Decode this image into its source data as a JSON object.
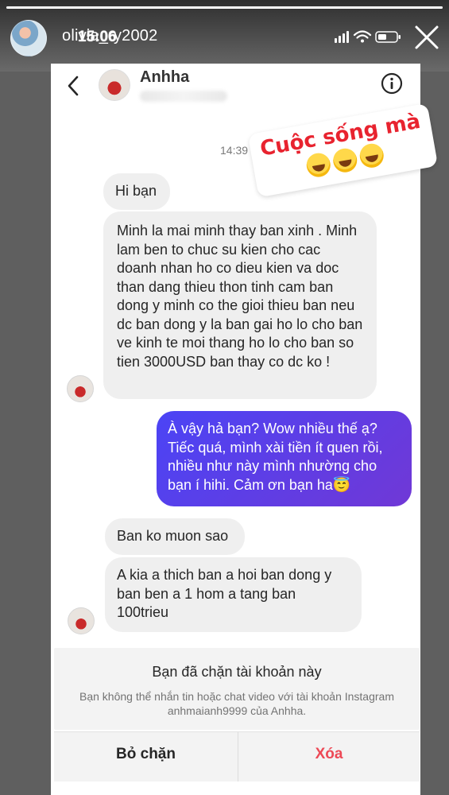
{
  "story": {
    "username": "olivia_ry2002",
    "time": "15:06"
  },
  "chat": {
    "contact_name": "Anhha",
    "timestamp": "14:39"
  },
  "messages": [
    {
      "from": "contact",
      "text": "Hi bạn"
    },
    {
      "from": "contact",
      "text": "Minh la mai minh thay ban xinh . Minh lam  ben to chuc su kien cho cac doanh nhan ho co dieu kien va doc than dang thieu thon tinh cam ban dong y minh co the gioi thieu ban neu dc ban dong y la ban gai ho lo cho ban ve kinh te moi thang ho lo cho ban so tien 3000USD ban thay co dc ko !"
    },
    {
      "from": "me",
      "text": "À vậy hả bạn? Wow nhiều thế ạ? Tiếc quá, mình xài tiền ít quen rồi, nhiều như này mình nhường cho bạn í hihi. Cảm ơn bạn ha😇"
    },
    {
      "from": "contact",
      "text": "Ban ko muon sao"
    },
    {
      "from": "contact",
      "text": "A kia a thich ban a hoi ban dong y ban ben a 1 hom a tang ban 100trieu"
    }
  ],
  "sticker": {
    "text": "Cuộc sống mà",
    "emoji": "🤣🤣🤣"
  },
  "blocked": {
    "title": "Bạn đã chặn tài khoản này",
    "description": "Bạn không thể nhắn tin hoặc chat video với tài khoản Instagram anhmaianh9999 của Anhha."
  },
  "actions": {
    "unblock_label": "Bỏ chặn",
    "delete_label": "Xóa"
  },
  "colors": {
    "outgoing_bubble_start": "#4b44f5",
    "outgoing_bubble_end": "#7038d6",
    "delete_red": "#ed4956",
    "sticker_red": "#e8232f"
  }
}
